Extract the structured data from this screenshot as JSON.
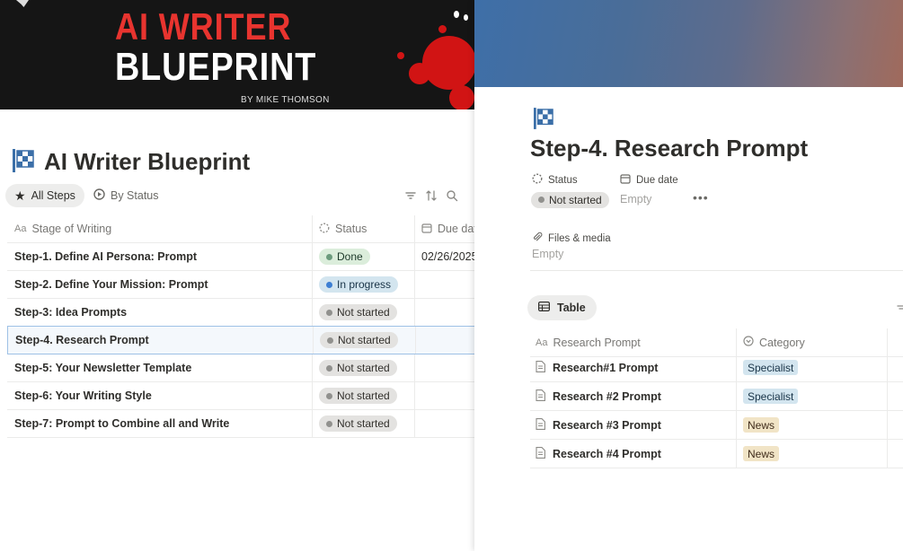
{
  "left": {
    "cover": {
      "line1": "AI WRITER",
      "line2": "BLUEPRINT",
      "byline": "BY MIKE THOMSON"
    },
    "icon": "checkered-flag-icon",
    "title": "AI Writer Blueprint",
    "tabs": [
      {
        "label": "All Steps",
        "icon": "star-icon",
        "active": true
      },
      {
        "label": "By Status",
        "icon": "status-circle-icon",
        "active": false
      }
    ],
    "toolbar_icons": [
      "filter-icon",
      "sort-icon",
      "search-icon"
    ],
    "columns": [
      "Stage of Writing",
      "Status",
      "Due date"
    ],
    "rows": [
      {
        "name": "Step-1. Define AI Persona: Prompt",
        "status": "Done",
        "status_class": "done",
        "due": "02/26/2025"
      },
      {
        "name": "Step-2. Define Your Mission: Prompt",
        "status": "In progress",
        "status_class": "progress",
        "due": ""
      },
      {
        "name": "Step-3: Idea Prompts",
        "status": "Not started",
        "status_class": "notstarted",
        "due": ""
      },
      {
        "name": "Step-4. Research Prompt",
        "status": "Not started",
        "status_class": "notstarted",
        "due": "",
        "selected": true
      },
      {
        "name": "Step-5: Your Newsletter Template",
        "status": "Not started",
        "status_class": "notstarted",
        "due": ""
      },
      {
        "name": "Step-6: Your Writing Style",
        "status": "Not started",
        "status_class": "notstarted",
        "due": ""
      },
      {
        "name": "Step-7: Prompt to Combine all and Write",
        "status": "Not started",
        "status_class": "notstarted",
        "due": ""
      }
    ]
  },
  "right": {
    "icon": "checkered-flag-icon",
    "title": "Step-4. Research Prompt",
    "properties": {
      "status_label": "Status",
      "status_value": "Not started",
      "due_label": "Due date",
      "due_value": "Empty",
      "files_label": "Files & media",
      "files_value": "Empty",
      "more": "•••"
    },
    "view_tab": "Table",
    "columns": [
      "Research Prompt",
      "Category"
    ],
    "rows": [
      {
        "name": "Research#1 Prompt",
        "category": "Specialist",
        "color": "blue"
      },
      {
        "name": "Research #2 Prompt",
        "category": "Specialist",
        "color": "blue"
      },
      {
        "name": "Research #3 Prompt",
        "category": "News",
        "color": "yellow"
      },
      {
        "name": "Research #4 Prompt",
        "category": "News",
        "color": "yellow"
      }
    ]
  },
  "colors": {
    "done": "#dbeddb",
    "in_progress": "#d3e5ef",
    "not_started": "#e3e2e0",
    "tag_blue": "#d3e5ef",
    "tag_yellow": "#f1e4c6",
    "cover_red": "#e8342f"
  }
}
